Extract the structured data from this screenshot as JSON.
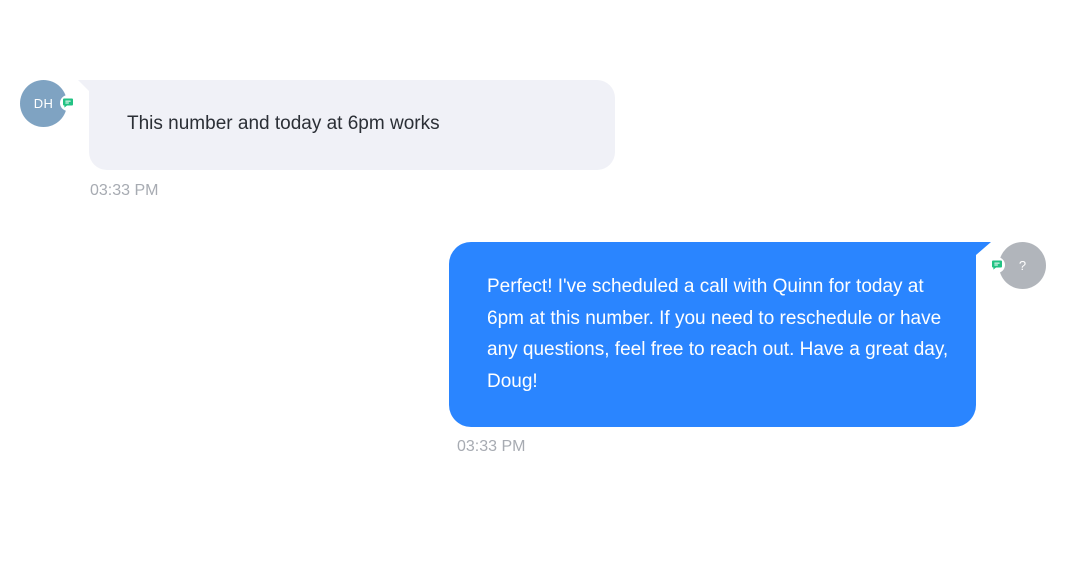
{
  "conversation": {
    "messages": [
      {
        "direction": "incoming",
        "avatar_initials": "DH",
        "avatar_color": "#7fa3c2",
        "channel_icon": "sms-chat-icon",
        "channel_color": "#22c283",
        "text": "This number and today at 6pm works",
        "time": "03:33 PM"
      },
      {
        "direction": "outgoing",
        "avatar_initials": "?",
        "avatar_color": "#b1b5bb",
        "channel_icon": "sms-chat-icon",
        "channel_color": "#22c283",
        "text": "Perfect! I've scheduled a call with Quinn for today at 6pm at this number. If you need to reschedule or have any questions, feel free to reach out. Have a great day, Doug!",
        "time": "03:33 PM"
      }
    ]
  },
  "colors": {
    "incoming_bubble": "#f0f1f7",
    "outgoing_bubble": "#2a85ff",
    "timestamp": "#a7abb2"
  }
}
